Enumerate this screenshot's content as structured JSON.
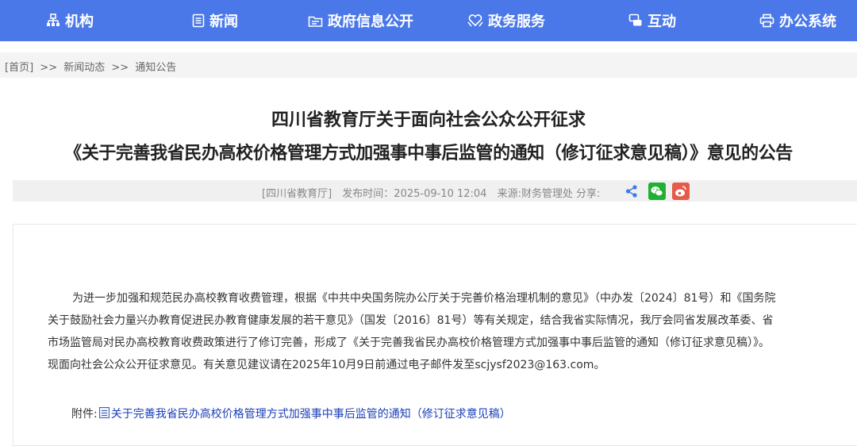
{
  "nav": {
    "items": [
      {
        "label": "机构",
        "icon": "org-chart-icon"
      },
      {
        "label": "新闻",
        "icon": "news-icon"
      },
      {
        "label": "政府信息公开",
        "icon": "folder-info-icon"
      },
      {
        "label": "政务服务",
        "icon": "heart-hands-icon"
      },
      {
        "label": "互动",
        "icon": "chat-icon"
      },
      {
        "label": "办公系统",
        "icon": "printer-icon"
      }
    ]
  },
  "breadcrumb": {
    "home": "[首页]",
    "sep": ">>",
    "level1": "新闻动态",
    "level2": "通知公告"
  },
  "article": {
    "title_line1": "四川省教育厅关于面向社会公众公开征求",
    "title_line2": "《关于完善我省民办高校价格管理方式加强事中事后监管的通知（修订征求意见稿）》意见的公告",
    "meta": {
      "publisher": "[四川省教育厅]",
      "publish_time": "发布时间：2025-09-10 12:04",
      "source": "来源:财务管理处",
      "share_label": "分享:"
    },
    "body_lines": [
      "为进一步加强和规范民办高校教育收费管理，根据《中共中央国务院办公厅关于完善价格治理机制的意见》（中办发〔2024〕81号）和《国务院",
      "关于鼓励社会力量兴办教育促进民办教育健康发展的若干意见》（国发〔2016〕81号）等有关规定，结合我省实际情况，我厅会同省发展改革委、省",
      "市场监管局对民办高校教育收费政策进行了修订完善，形成了《关于完善我省民办高校价格管理方式加强事中事后监管的通知（修订征求意见稿）》。",
      "现面向社会公众公开征求意见。有关意见建议请在2025年10月9日前通过电子邮件发至scjysf2023@163.com。"
    ],
    "attachment_label": "附件:",
    "attachment_link": "关于完善我省民办高校价格管理方式加强事中事后监管的通知（修订征求意见稿）"
  },
  "colors": {
    "nav_bg": "#4a78e8",
    "link": "#1a3fb8",
    "wechat": "#21b033",
    "weibo": "#e45b4b",
    "share": "#3b7be8"
  }
}
